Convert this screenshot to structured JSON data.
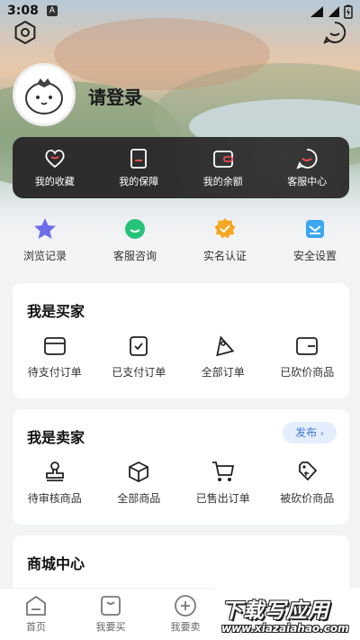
{
  "status_bar": {
    "time": "3:08",
    "sim_badge": "A"
  },
  "profile": {
    "login_text": "请登录"
  },
  "dark_bar": {
    "items": [
      {
        "label": "我的收藏",
        "icon": "heart-icon"
      },
      {
        "label": "我的保障",
        "icon": "document-icon"
      },
      {
        "label": "我的余额",
        "icon": "wallet-icon"
      },
      {
        "label": "客服中心",
        "icon": "chat-icon"
      }
    ]
  },
  "quick_links": [
    {
      "label": "浏览记录",
      "icon": "star-icon",
      "color": "#6f6de8"
    },
    {
      "label": "客服咨询",
      "icon": "chat-bubble-icon",
      "color": "#27c27a"
    },
    {
      "label": "实名认证",
      "icon": "badge-check-icon",
      "color": "#f5a623"
    },
    {
      "label": "安全设置",
      "icon": "mail-icon",
      "color": "#3aa7f0"
    }
  ],
  "buyer": {
    "title": "我是买家",
    "items": [
      {
        "label": "待支付订单",
        "icon": "card-icon"
      },
      {
        "label": "已支付订单",
        "icon": "clipboard-check-icon"
      },
      {
        "label": "全部订单",
        "icon": "tag-icon"
      },
      {
        "label": "已砍价商品",
        "icon": "wallet-icon"
      }
    ]
  },
  "seller": {
    "title": "我是卖家",
    "publish_label": "发布",
    "items": [
      {
        "label": "待审核商品",
        "icon": "stamp-icon"
      },
      {
        "label": "全部商品",
        "icon": "box-icon"
      },
      {
        "label": "已售出订单",
        "icon": "cart-icon"
      },
      {
        "label": "被砍价商品",
        "icon": "price-tag-icon"
      }
    ]
  },
  "mall": {
    "title": "商城中心"
  },
  "tab_bar": [
    {
      "label": "首页",
      "icon": "home-icon"
    },
    {
      "label": "我要买",
      "icon": "bag-icon"
    },
    {
      "label": "我要卖",
      "icon": "plus-circle-icon"
    }
  ],
  "watermark": {
    "line1": "下载写应用",
    "line2": "www.xiazaiahao.com"
  }
}
